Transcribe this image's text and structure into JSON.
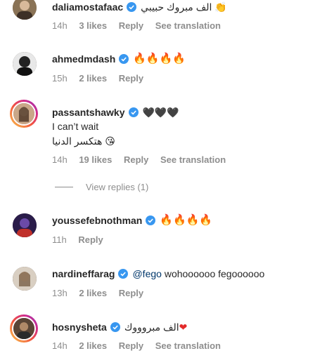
{
  "comments": [
    {
      "username": "daliamostafaac",
      "text": "الف مبروك حبيبي 👏",
      "time": "14h",
      "likes": "3 likes",
      "reply": "Reply",
      "translate": "See translation"
    },
    {
      "username": "ahmedmdash",
      "text": "🔥🔥🔥🔥",
      "time": "15h",
      "likes": "2 likes",
      "reply": "Reply"
    },
    {
      "username": "passantshawky",
      "text": "🖤🖤🖤",
      "text2": "I can’t wait",
      "text3": "هتكسر الدنيا 😘",
      "time": "14h",
      "likes": "19 likes",
      "reply": "Reply",
      "translate": "See translation",
      "view_replies": "View replies (1)"
    },
    {
      "username": "youssefebnothman",
      "text": "🔥🔥🔥🔥",
      "time": "11h",
      "reply": "Reply"
    },
    {
      "username": "nardineffarag",
      "mention": "@fego",
      "text": " wohoooooo fegoooooo",
      "time": "13h",
      "likes": "2 likes",
      "reply": "Reply"
    },
    {
      "username": "hosnysheta",
      "text": "الف مبروووك",
      "heart": "❤",
      "time": "14h",
      "likes": "2 likes",
      "reply": "Reply",
      "translate": "See translation"
    }
  ],
  "colors": {
    "verified": "#3897f0",
    "meta": "#8e8e8e",
    "mention": "#00376b"
  }
}
